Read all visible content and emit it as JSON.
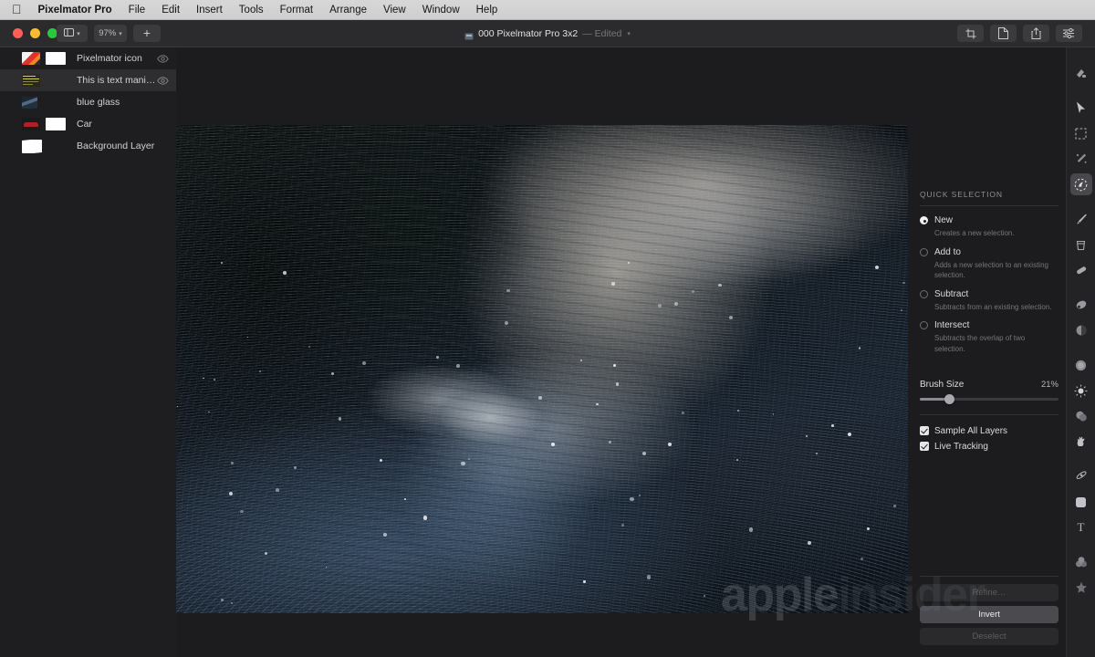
{
  "menubar": {
    "apple_icon": "apple-logo-icon",
    "items": [
      {
        "label": "Pixelmator Pro",
        "bold": true
      },
      {
        "label": "File"
      },
      {
        "label": "Edit"
      },
      {
        "label": "Insert"
      },
      {
        "label": "Tools"
      },
      {
        "label": "Format"
      },
      {
        "label": "Arrange"
      },
      {
        "label": "View"
      },
      {
        "label": "Window"
      },
      {
        "label": "Help"
      }
    ]
  },
  "titlebar": {
    "zoom_level": "97%",
    "add_label": "+",
    "document_name": "000 Pixelmator Pro 3x2",
    "edited_label": "— Edited",
    "right_buttons": [
      {
        "name": "crop-tool-button",
        "icon": "crop-icon"
      },
      {
        "name": "document-button",
        "icon": "document-icon"
      },
      {
        "name": "share-button",
        "icon": "share-icon"
      },
      {
        "name": "adjustments-button",
        "icon": "sliders-icon"
      }
    ]
  },
  "sidebar": {
    "layers": [
      {
        "name": "Pixelmator icon",
        "thumb": "pixelmator-icon-thumb",
        "has_mask": true,
        "visible": true,
        "selected": false
      },
      {
        "name": "This is text manipulatio…",
        "thumb": "text-layer-thumb",
        "has_mask": false,
        "visible": true,
        "selected": true
      },
      {
        "name": "blue glass",
        "thumb": "blue-glass-thumb",
        "has_mask": false,
        "visible": false,
        "selected": false
      },
      {
        "name": "Car",
        "thumb": "car-thumb",
        "has_mask": true,
        "visible": false,
        "selected": false
      },
      {
        "name": "Background Layer",
        "thumb": "background-thumb",
        "has_mask": false,
        "visible": false,
        "selected": false
      }
    ]
  },
  "panel": {
    "title": "QUICK SELECTION",
    "options": [
      {
        "label": "New",
        "desc": "Creates a new selection.",
        "selected": true
      },
      {
        "label": "Add to",
        "desc": "Adds a new selection to an existing selection.",
        "selected": false
      },
      {
        "label": "Subtract",
        "desc": "Subtracts from an existing selection.",
        "selected": false
      },
      {
        "label": "Intersect",
        "desc": "Subtracts the overlap of two selection.",
        "selected": false
      }
    ],
    "brush_size_label": "Brush Size",
    "brush_size_value": "21%",
    "brush_size_pct": 21,
    "checkboxes": [
      {
        "label": "Sample All Layers",
        "checked": true
      },
      {
        "label": "Live Tracking",
        "checked": true
      }
    ],
    "buttons": [
      {
        "label": "Refine…",
        "enabled": false
      },
      {
        "label": "Invert",
        "enabled": true
      },
      {
        "label": "Deselect",
        "enabled": false
      }
    ]
  },
  "tools": [
    {
      "name": "arrange-tool",
      "icon": "arrange-icon",
      "active": false
    },
    {
      "name": "move-tool",
      "icon": "arrow-cursor-icon",
      "active": false
    },
    {
      "name": "rectangular-marquee-tool",
      "icon": "marquee-icon",
      "active": false
    },
    {
      "name": "magic-wand-tool",
      "icon": "magic-wand-icon",
      "active": false
    },
    {
      "name": "quick-selection-tool",
      "icon": "quick-selection-icon",
      "active": true
    },
    {
      "name": "paint-tool",
      "icon": "paintbrush-icon",
      "active": false
    },
    {
      "name": "paint-bucket-tool",
      "icon": "paint-bucket-icon",
      "active": false
    },
    {
      "name": "eraser-tool",
      "icon": "eraser-icon",
      "active": false
    },
    {
      "name": "clone-stamp-tool",
      "icon": "clone-stamp-icon",
      "active": false
    },
    {
      "name": "smudge-tool",
      "icon": "smudge-icon",
      "active": false
    },
    {
      "name": "blur-tool",
      "icon": "blur-icon",
      "active": false
    },
    {
      "name": "lighten-tool",
      "icon": "lighten-sun-icon",
      "active": false
    },
    {
      "name": "darken-tool",
      "icon": "darken-icon",
      "active": false
    },
    {
      "name": "sponge-tool",
      "icon": "sponge-hand-icon",
      "active": false
    },
    {
      "name": "pen-tool",
      "icon": "pen-icon",
      "active": false
    },
    {
      "name": "shape-tool",
      "icon": "rounded-rect-icon",
      "active": false
    },
    {
      "name": "type-tool",
      "icon": "type-T-icon",
      "active": false
    },
    {
      "name": "color-adjust-tool",
      "icon": "color-circles-icon",
      "active": false
    },
    {
      "name": "effects-tool",
      "icon": "sparkle-icon",
      "active": false
    }
  ],
  "watermark": {
    "part1": "apple",
    "part2": "insider"
  },
  "colors": {
    "menubar_bg": "#d4d4d4",
    "window_bg": "#1e1e20",
    "titlebar_bg": "#2b2b2d",
    "panel_text": "#dcdce0",
    "accent_selected_row": "#2e2e31",
    "traffic_red": "#ff5f57",
    "traffic_yellow": "#febc2e",
    "traffic_green": "#28c840"
  }
}
